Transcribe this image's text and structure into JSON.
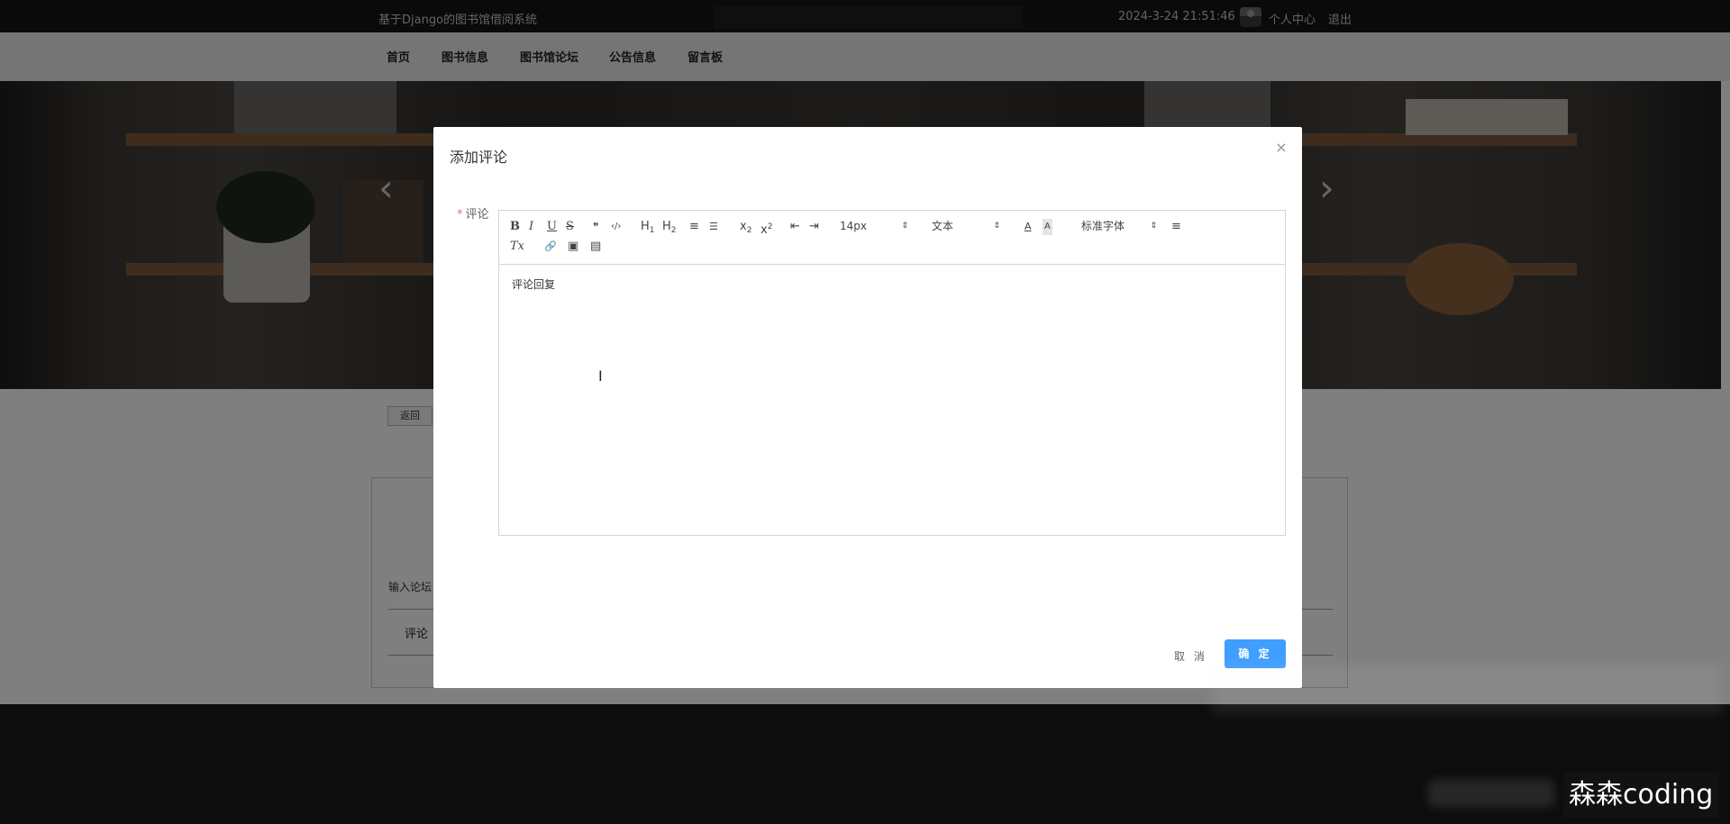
{
  "topbar": {
    "site_title": "基于Django的图书馆借阅系统",
    "datetime": "2024-3-24 21:51:46",
    "profile_label": "个人中心",
    "logout_label": "退出"
  },
  "nav": {
    "items": [
      "首页",
      "图书信息",
      "图书馆论坛",
      "公告信息",
      "留言板"
    ]
  },
  "banner": {
    "prev_icon": "‹",
    "next_icon": "›"
  },
  "page": {
    "back_label": "返回",
    "forum_label": "输入论坛",
    "comment_tab_label": "评论"
  },
  "modal": {
    "title": "添加评论",
    "close_icon": "×",
    "field_required_mark": "*",
    "field_label": "评论",
    "toolbar": {
      "bold": "B",
      "italic": "I",
      "underline": "U",
      "strike": "S",
      "blockquote": "❞",
      "code": "‹/›",
      "h1": "H",
      "h1_sub": "1",
      "h2": "H",
      "h2_sub": "2",
      "ordered_list": "≡",
      "bullet_list": "☰",
      "subscript": "x",
      "subscript_mark": "2",
      "superscript": "x",
      "superscript_mark": "2",
      "outdent": "⇤",
      "indent": "⇥",
      "font_size_value": "14px",
      "header_value": "文本",
      "color": "A",
      "background": "A",
      "font_value": "标准字体",
      "align": "≡",
      "clean": "Tx",
      "link": "🔗",
      "image": "▣",
      "video": "▤",
      "caret": "⇕"
    },
    "content": "评论回复",
    "cancel_label": "取 消",
    "confirm_label": "确 定"
  },
  "watermark": "森森coding",
  "colors": {
    "primary": "#409eff",
    "required": "#f56c6c",
    "topbar_bg": "#141414",
    "footer_bg": "#1b1b1b"
  }
}
